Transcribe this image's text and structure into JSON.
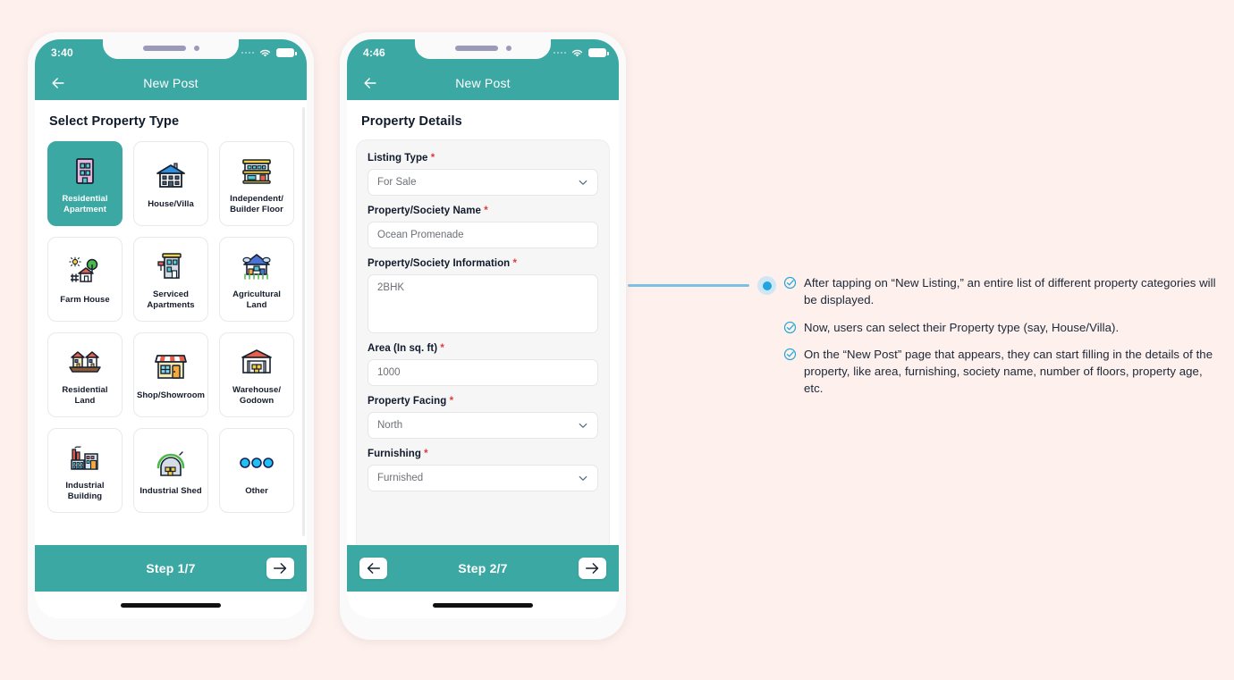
{
  "theme": {
    "teal": "#3ba8a3",
    "page_background": "#fdf0ed",
    "accent_blue": "#20a5e0",
    "required_star": "#e03a3a"
  },
  "phone1": {
    "status": {
      "time": "3:40",
      "wifi_icon": "wifi-icon",
      "battery_icon": "battery-icon",
      "signal_icon": "signal-dots-icon"
    },
    "appbar": {
      "back_icon": "back-arrow-icon",
      "title": "New Post"
    },
    "section_title": "Select Property Type",
    "property_types": [
      {
        "label": "Residential Apartment",
        "icon": "apartment-building-icon",
        "selected": true
      },
      {
        "label": "House/Villa",
        "icon": "house-villa-icon",
        "selected": false
      },
      {
        "label": "Independent/ Builder Floor",
        "icon": "builder-floor-icon",
        "selected": false
      },
      {
        "label": "Farm House",
        "icon": "farm-house-icon",
        "selected": false
      },
      {
        "label": "Serviced Apartments",
        "icon": "serviced-apartments-icon",
        "selected": false
      },
      {
        "label": "Agricultural Land",
        "icon": "agricultural-land-icon",
        "selected": false
      },
      {
        "label": "Residential Land",
        "icon": "residential-land-icon",
        "selected": false
      },
      {
        "label": "Shop/Showroom",
        "icon": "shop-showroom-icon",
        "selected": false
      },
      {
        "label": "Warehouse/ Godown",
        "icon": "warehouse-godown-icon",
        "selected": false
      },
      {
        "label": "Industrial Building",
        "icon": "industrial-building-icon",
        "selected": false
      },
      {
        "label": "Industrial Shed",
        "icon": "industrial-shed-icon",
        "selected": false
      },
      {
        "label": "Other",
        "icon": "three-dots-icon",
        "selected": false
      }
    ],
    "stepbar": {
      "step_label": "Step 1/7",
      "next_icon": "arrow-right-icon"
    }
  },
  "phone2": {
    "status": {
      "time": "4:46",
      "wifi_icon": "wifi-icon",
      "battery_icon": "battery-icon",
      "signal_icon": "signal-dots-icon"
    },
    "appbar": {
      "back_icon": "back-arrow-icon",
      "title": "New Post"
    },
    "section_title": "Property Details",
    "fields": [
      {
        "label": "Listing Type",
        "required": "*",
        "value": "For Sale",
        "type": "select"
      },
      {
        "label": "Property/Society Name",
        "required": "*",
        "value": "Ocean Promenade",
        "type": "text"
      },
      {
        "label": "Property/Society  Information",
        "required": "*",
        "value": "2BHK",
        "type": "textarea"
      },
      {
        "label": "Area (In sq. ft)",
        "required": "*",
        "value": "1000",
        "type": "text"
      },
      {
        "label": "Property Facing",
        "required": "*",
        "value": "North",
        "type": "select"
      },
      {
        "label": "Furnishing",
        "required": "*",
        "value": "Furnished",
        "type": "select"
      }
    ],
    "stepbar": {
      "step_label": "Step 2/7",
      "prev_icon": "arrow-left-icon",
      "next_icon": "arrow-right-icon"
    }
  },
  "annotation": {
    "marker_icon": "bullet-dot-icon",
    "notes": [
      {
        "icon": "check-circle-icon",
        "text": "After tapping on “New Listing,” an entire list of different property categories will be displayed."
      },
      {
        "icon": "check-circle-icon",
        "text": "Now, users can select their Property type (say, House/Villa)."
      },
      {
        "icon": "check-circle-icon",
        "text": "On the “New Post” page that appears, they can start filling in the details of the property, like area, furnishing, society name, number of floors, property age, etc."
      }
    ]
  }
}
